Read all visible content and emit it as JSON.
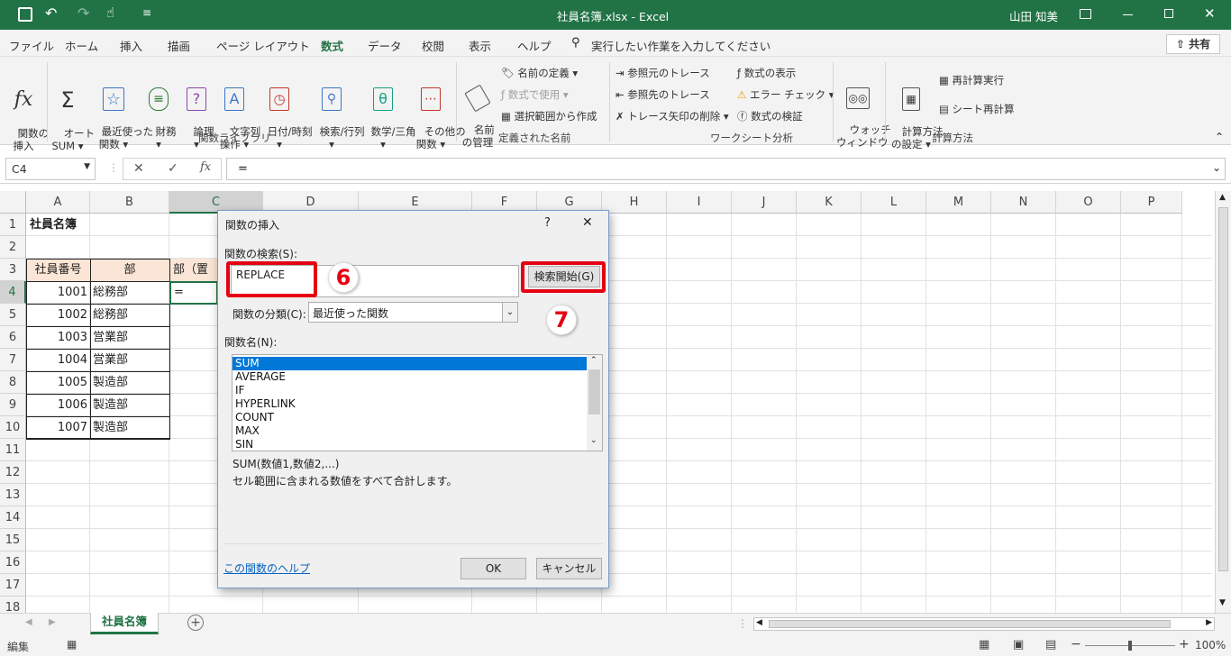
{
  "window": {
    "title": "社員名簿.xlsx  -  Excel",
    "user": "山田 知美"
  },
  "ribbon_tabs": [
    "ファイル",
    "ホーム",
    "挿入",
    "描画",
    "ページ レイアウト",
    "数式",
    "データ",
    "校閲",
    "表示",
    "ヘルプ"
  ],
  "active_tab": "数式",
  "tell_me": "実行したい作業を入力してください",
  "share": "共有",
  "ribbon": {
    "insert_function": "関数の\n挿入",
    "autosum": "オート\nSUM ▾",
    "recent": "最近使った\n関数 ▾",
    "financial": "財務\n▾",
    "logical": "論理\n▾",
    "text": "文字列\n操作 ▾",
    "datetime": "日付/時刻\n▾",
    "lookup": "検索/行列\n▾",
    "math": "数学/三角\n▾",
    "more": "その他の\n関数 ▾",
    "group_library": "関数ライブラリ",
    "name_manager": "名前\nの管理",
    "define_name": "名前の定義  ▾",
    "use_in_formula": "数式で使用 ▾",
    "create_from_selection": "選択範囲から作成",
    "group_names": "定義された名前",
    "trace_precedents": "参照元のトレース",
    "trace_dependents": "参照先のトレース",
    "remove_arrows": "トレース矢印の削除  ▾",
    "show_formulas": "数式の表示",
    "error_check": "エラー チェック  ▾",
    "evaluate": "数式の検証",
    "watch": "ウォッチ\nウィンドウ",
    "group_audit": "ワークシート分析",
    "calc_options": "計算方法\nの設定 ▾",
    "calc_now": "再計算実行",
    "calc_sheet": "シート再計算",
    "group_calc": "計算方法"
  },
  "formula_bar": {
    "name_box": "C4",
    "formula": "="
  },
  "columns": [
    "A",
    "B",
    "C",
    "D",
    "E",
    "F",
    "G",
    "H",
    "I",
    "J",
    "K",
    "L",
    "M",
    "N",
    "O",
    "P"
  ],
  "rows": [
    "1",
    "2",
    "3",
    "4",
    "5",
    "6",
    "7",
    "8",
    "9",
    "10",
    "11",
    "12",
    "13",
    "14",
    "15",
    "16",
    "17",
    "18"
  ],
  "sheet": {
    "a1": "社員名簿",
    "h_no": "社員番号",
    "h_dept": "部",
    "h_c": "部（置",
    "c4": "=",
    "ids": [
      "1001",
      "1002",
      "1003",
      "1004",
      "1005",
      "1006",
      "1007"
    ],
    "depts": [
      "総務部",
      "総務部",
      "営業部",
      "営業部",
      "製造部",
      "製造部",
      "製造部"
    ]
  },
  "sheet_tab": "社員名簿",
  "status": {
    "mode": "編集",
    "zoom": "100%"
  },
  "dialog": {
    "title": "関数の挿入",
    "help_q": "?",
    "close": "✕",
    "search_label": "関数の検索(S):",
    "search_value": "REPLACE",
    "go_button": "検索開始(G)",
    "category_label": "関数の分類(C):",
    "category_value": "最近使った関数",
    "list_label": "関数名(N):",
    "functions": [
      "SUM",
      "AVERAGE",
      "IF",
      "HYPERLINK",
      "COUNT",
      "MAX",
      "SIN"
    ],
    "signature": "SUM(数値1,数値2,...)",
    "description": "セル範囲に含まれる数値をすべて合計します。",
    "help_link": "この関数のヘルプ",
    "ok": "OK",
    "cancel": "キャンセル"
  },
  "callouts": {
    "step6": "6",
    "step7": "7"
  },
  "colors": {
    "excel_green": "#217346",
    "callout_red": "#e60012",
    "select_blue": "#0078d7"
  }
}
